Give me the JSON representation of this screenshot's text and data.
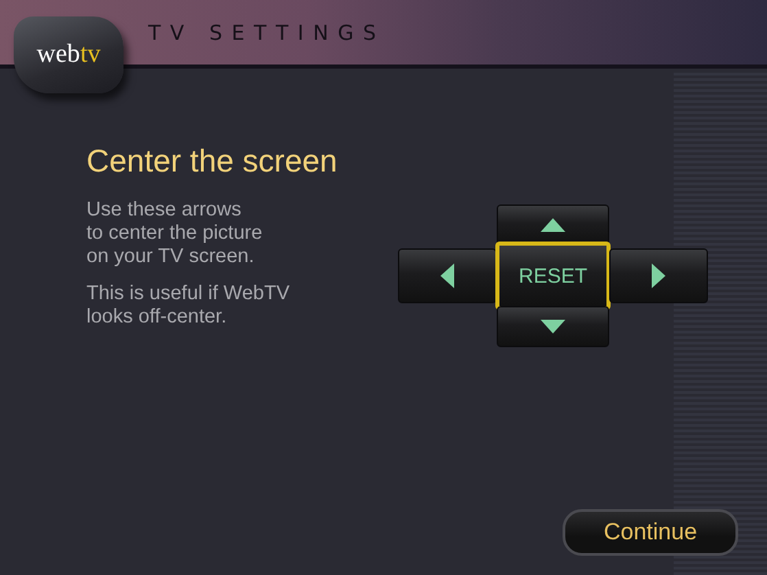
{
  "header": {
    "title": "T V   S E T T I N G S",
    "logo": {
      "first": "web",
      "second": "tv"
    }
  },
  "heading": "Center the screen",
  "paragraphs": [
    "Use these arrows\nto center the picture\non your TV screen.",
    "This is useful if WebTV\nlooks off-center."
  ],
  "dpad": [
    {
      "kind": "up",
      "selected": false
    },
    {
      "kind": "left",
      "selected": false
    },
    {
      "kind": "reset",
      "label": "RESET",
      "selected": true
    },
    {
      "kind": "right",
      "selected": false
    },
    {
      "kind": "down",
      "selected": false
    }
  ],
  "continue_button": "Continue"
}
